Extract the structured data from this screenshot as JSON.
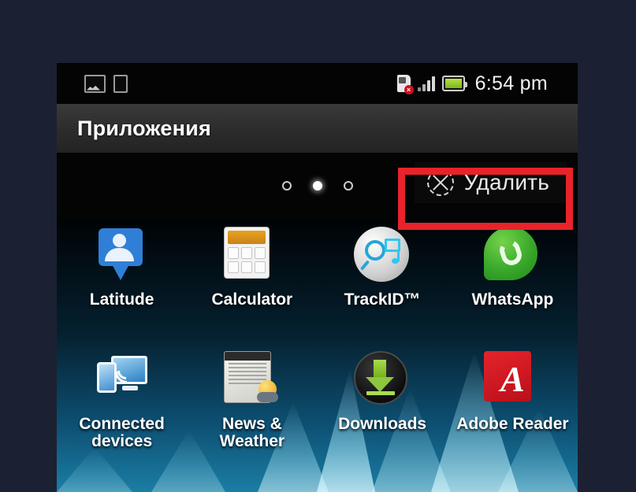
{
  "phone": {
    "statusbar": {
      "left_icons": [
        "gallery-icon",
        "document-icon"
      ],
      "right_icons": [
        "sim-card-error-icon",
        "signal-bars-icon",
        "battery-icon"
      ],
      "time": "6:54 pm"
    },
    "titlebar": {
      "title": "Приложения"
    },
    "actionbar": {
      "delete_label": "Удалить",
      "delete_icon": "circle-x-icon",
      "pages": {
        "count": 3,
        "active_index": 1
      }
    },
    "apps": [
      {
        "name": "Latitude",
        "icon": "latitude-icon"
      },
      {
        "name": "Calculator",
        "icon": "calculator-icon"
      },
      {
        "name": "TrackID™",
        "icon": "trackid-icon"
      },
      {
        "name": "WhatsApp",
        "icon": "whatsapp-icon"
      },
      {
        "name": "Connected\ndevices",
        "icon": "connected-devices-icon"
      },
      {
        "name": "News &\nWeather",
        "icon": "news-weather-icon"
      },
      {
        "name": "Downloads",
        "icon": "downloads-icon"
      },
      {
        "name": "Adobe Reader",
        "icon": "adobe-reader-icon"
      }
    ]
  },
  "annotation": {
    "type": "highlight-rectangle",
    "color": "#e8232a",
    "targets": "delete-button"
  },
  "colors": {
    "page_background": "#1b2132",
    "status_bar": "#040404",
    "title_bar": "#2e2e2e",
    "accent_red": "#e8232a",
    "battery_green": "#8dc63f",
    "whatsapp_green": "#39a82b",
    "adobe_red": "#e5232b"
  }
}
